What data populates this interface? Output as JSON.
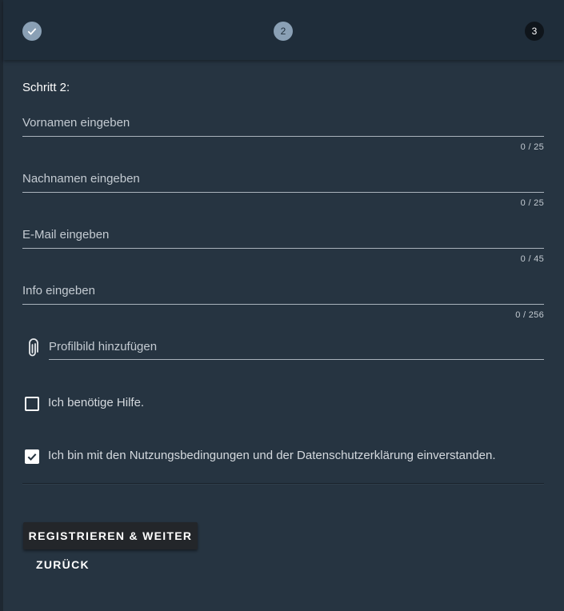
{
  "stepper": {
    "steps": [
      {
        "label": "",
        "state": "done",
        "icon": "check-icon"
      },
      {
        "label": "2",
        "state": "active"
      },
      {
        "label": "3",
        "state": "upcoming"
      }
    ]
  },
  "form": {
    "title": "Schritt 2:",
    "fields": [
      {
        "label": "Vornamen eingeben",
        "counter": "0 / 25"
      },
      {
        "label": "Nachnamen eingeben",
        "counter": "0 / 25"
      },
      {
        "label": "E-Mail eingeben",
        "counter": "0 / 45"
      },
      {
        "label": "Info eingeben",
        "counter": "0 / 256"
      }
    ],
    "file": {
      "label": "Profilbild hinzufügen",
      "icon": "paperclip-icon"
    },
    "checkboxes": [
      {
        "label": "Ich benötige Hilfe.",
        "checked": false
      },
      {
        "label": "Ich bin mit den Nutzungsbedingungen und der Datenschutzerklärung einverstanden.",
        "checked": true
      }
    ]
  },
  "actions": {
    "primary_label": "REGISTRIEREN & WEITER",
    "back_label": "ZURÜCK"
  },
  "colors": {
    "background": "#263441",
    "header": "#1f2d3a",
    "step_active": "#8aa0b5",
    "step_upcoming": "#0f151b"
  }
}
